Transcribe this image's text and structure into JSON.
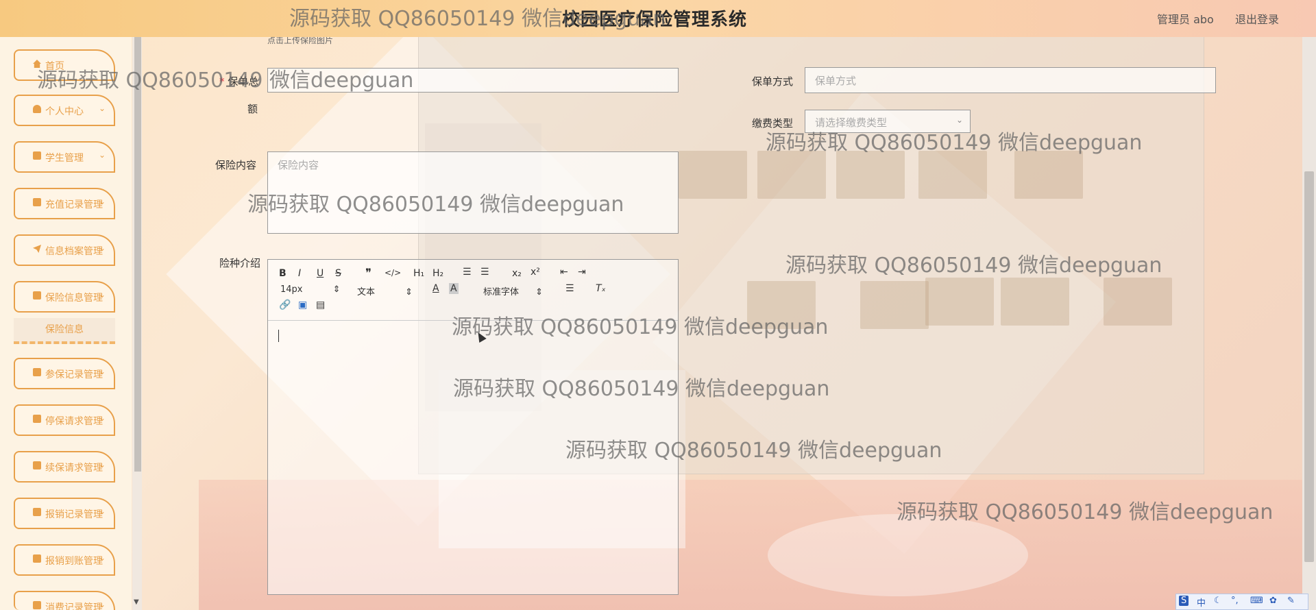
{
  "header": {
    "title": "校园医疗保险管理系统",
    "user_label": "管理员 abo",
    "logout": "退出登录"
  },
  "sidebar": {
    "items": [
      {
        "label": "首页"
      },
      {
        "label": "个人中心"
      },
      {
        "label": "学生管理"
      },
      {
        "label": "充值记录管理"
      },
      {
        "label": "信息档案管理"
      },
      {
        "label": "保险信息管理"
      },
      {
        "label": "参保记录管理"
      },
      {
        "label": "停保请求管理"
      },
      {
        "label": "续保请求管理"
      },
      {
        "label": "报销记录管理"
      },
      {
        "label": "报销到账管理"
      },
      {
        "label": "消费记录管理"
      }
    ],
    "active_sub": "保险信息"
  },
  "form": {
    "upload_hint": "点击上传保险图片",
    "amount_label": "保单总",
    "amount_label2": "额",
    "method_label": "保单方式",
    "method_placeholder": "保单方式",
    "fee_label": "缴费类型",
    "fee_placeholder": "请选择缴费类型",
    "content_label": "保险内容",
    "content_placeholder": "保险内容",
    "intro_label": "险种介绍"
  },
  "editor": {
    "font_size": "14px",
    "block_type": "文本",
    "font_family": "标准字体"
  },
  "watermarks": [
    "源码获取 QQ86050149 微信deepguan",
    "源码获取 QQ86050149 微信deepguan",
    "源码获取 QQ86050149 微信deepguan",
    "源码获取 QQ86050149 微信deepguan",
    "源码获取 QQ86050149 微信deepguan",
    "源码获取 QQ86050149 微信deepguan",
    "源码获取 QQ86050149 微信deepguan",
    "源码获取 QQ86050149 微信deepguan",
    "源码获取 QQ86050149 微信deepguan",
    "源码获取 QQ86050149 微信deepguan"
  ],
  "ime": {
    "s": "S",
    "zh": "中"
  },
  "colors": {
    "accent": "#e8a04a",
    "header_start": "#f7c980",
    "header_end": "#f8c9b3"
  }
}
